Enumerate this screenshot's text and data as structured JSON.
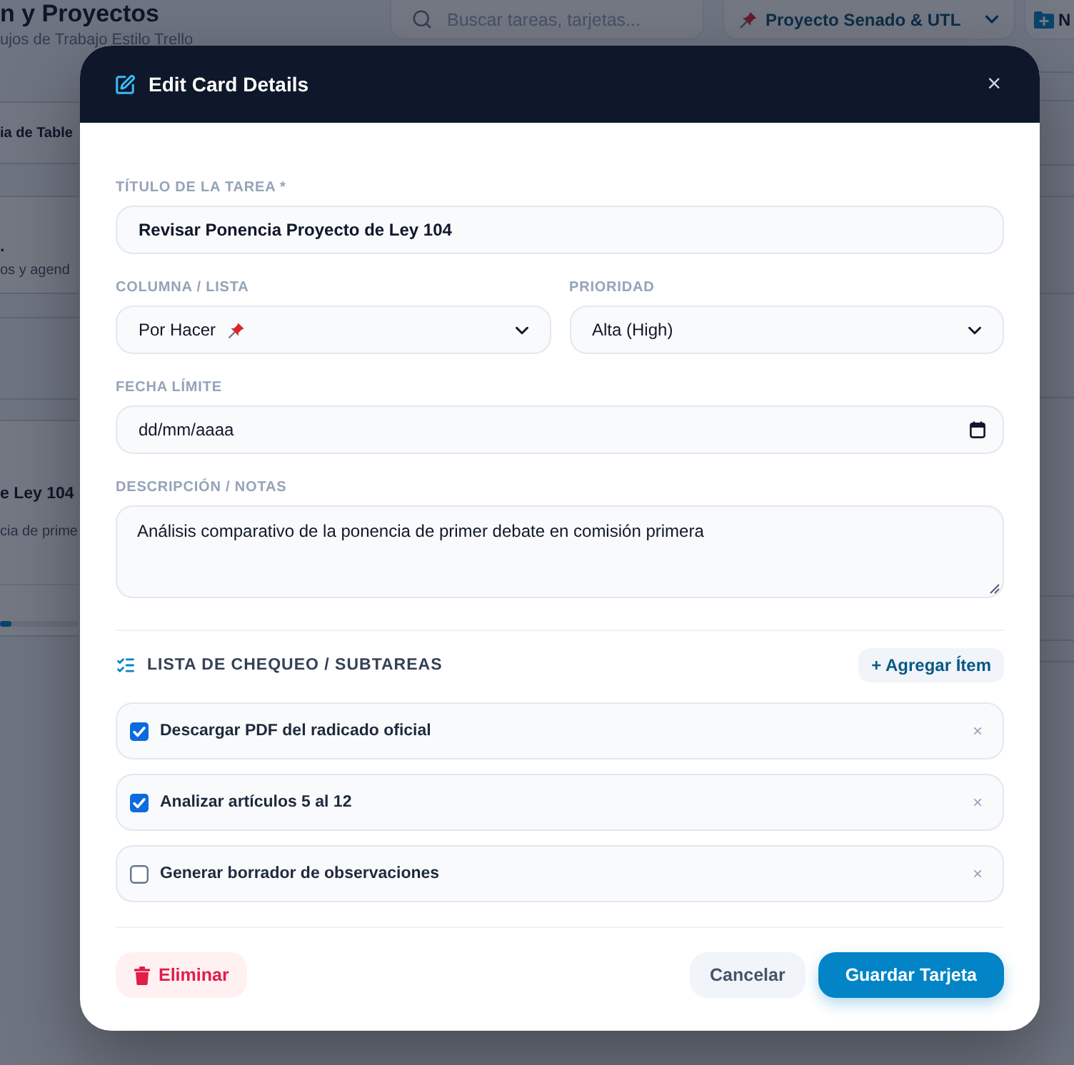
{
  "backdrop_app": {
    "title": "n y Proyectos",
    "subtitle": "ujos de Trabajo Estilo Trello",
    "search": {
      "placeholder": "Buscar tareas, tarjetas..."
    },
    "project_select": {
      "value": "Proyecto Senado & UTL"
    },
    "new_button": {
      "label": "N"
    },
    "column": {
      "header": "ia de Table",
      "cards": [
        {
          "title": ".",
          "subtitle": "os y agend"
        },
        {
          "title": "e Ley 104",
          "subtitle": "cia de prime",
          "level": 0.15
        }
      ]
    }
  },
  "modal": {
    "title": "Edit Card Details",
    "close": "×",
    "fields": [
      {
        "kind": "text",
        "label": "TÍTULO DE LA TAREA *",
        "value": "Revisar Ponencia Proyecto de Ley 104"
      },
      {
        "kind": "select",
        "label": "COLUMNA / LISTA",
        "value": "Por Hacer"
      },
      {
        "kind": "select",
        "label": "PRIORIDAD",
        "value": "Alta (High)"
      },
      {
        "kind": "date",
        "label": "FECHA LÍMITE",
        "placeholder": "dd/mm/aaaa"
      },
      {
        "kind": "textarea",
        "label": "DESCRIPCIÓN / NOTAS",
        "value": "Análisis comparativo de la ponencia de primer debate en comisión primera"
      }
    ],
    "checklist": {
      "title": "LISTA DE CHEQUEO / SUBTAREAS",
      "add_button": "+ Agregar Ítem",
      "items": [
        {
          "label": "Descargar PDF del radicado oficial",
          "checked": true,
          "remove": "×"
        },
        {
          "label": "Analizar artículos 5 al 12",
          "checked": true,
          "remove": "×"
        },
        {
          "label": "Generar borrador de observaciones",
          "checked": false,
          "remove": "×"
        }
      ]
    },
    "footer": {
      "delete_button": "Eliminar",
      "cancel_button": "Cancelar",
      "save_button": "Guardar Tarjeta"
    }
  }
}
